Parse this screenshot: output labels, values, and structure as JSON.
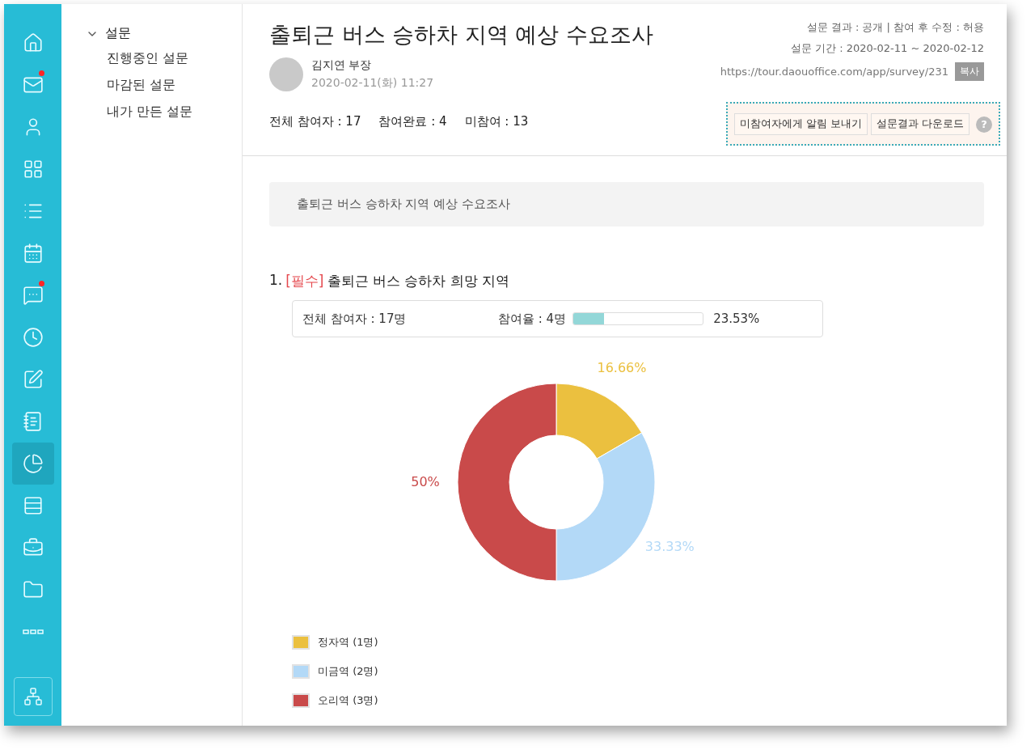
{
  "rail": {
    "items": [
      {
        "selected": false,
        "badge": false
      },
      {
        "selected": false,
        "badge": true
      },
      {
        "selected": false,
        "badge": false
      },
      {
        "selected": false,
        "badge": false
      },
      {
        "selected": false,
        "badge": false
      },
      {
        "selected": false,
        "badge": false
      },
      {
        "selected": false,
        "badge": true
      },
      {
        "selected": false,
        "badge": false
      },
      {
        "selected": false,
        "badge": false
      },
      {
        "selected": false,
        "badge": false
      },
      {
        "selected": true,
        "badge": false
      },
      {
        "selected": false,
        "badge": false
      },
      {
        "selected": false,
        "badge": false
      },
      {
        "selected": false,
        "badge": false
      },
      {
        "selected": false,
        "badge": false
      }
    ]
  },
  "nav": {
    "label": "설문",
    "expanded": true,
    "children": [
      {
        "label": "진행중인 설문",
        "selected": false
      },
      {
        "label": "마감된 설문",
        "selected": false
      },
      {
        "label": "내가 만든 설문",
        "selected": false
      }
    ]
  },
  "header": {
    "title": "출퇴근 버스 승하차 지역 예상 수요조사",
    "author": "김지연 부장",
    "date": "2020-02-11(화) 11:27",
    "meta": [
      "설문 결과 : 공개 | 참여 후 수정 : 허용",
      "설문 기간 : 2020-02-11 ~ 2020-02-12"
    ],
    "url": "https://tour.daouoffice.com/app/survey/231",
    "copy_button": "복사",
    "stats": [
      "전체 참여자 : 17",
      "참여완료 : 4",
      "미참여 : 13"
    ],
    "actions": [
      "미참여자에게 알림 보내기",
      "설문결과 다운로드"
    ],
    "help": "?"
  },
  "description": "출퇴근 버스 승하차 지역 예상 수요조사",
  "question": {
    "number": "1.",
    "required": "[필수]",
    "title": "출퇴근 버스 승하차 희망 지역",
    "total": "전체 참여자 : 17명",
    "rate_label": "참여율 : 4명",
    "level": 0.2353,
    "rate": "23.53%",
    "chart_data": {
      "type": "donut",
      "values": [
        16.66,
        33.33,
        50
      ],
      "value_labels": [
        "16.66%",
        "33.33%",
        "50%"
      ]
    },
    "legend": [
      {
        "label": "정자역 (1명)",
        "color": "#ebc03f"
      },
      {
        "label": "미금역 (2명)",
        "color": "#b3d9f7"
      },
      {
        "label": "오리역 (3명)",
        "color": "#c94a4a"
      }
    ]
  }
}
